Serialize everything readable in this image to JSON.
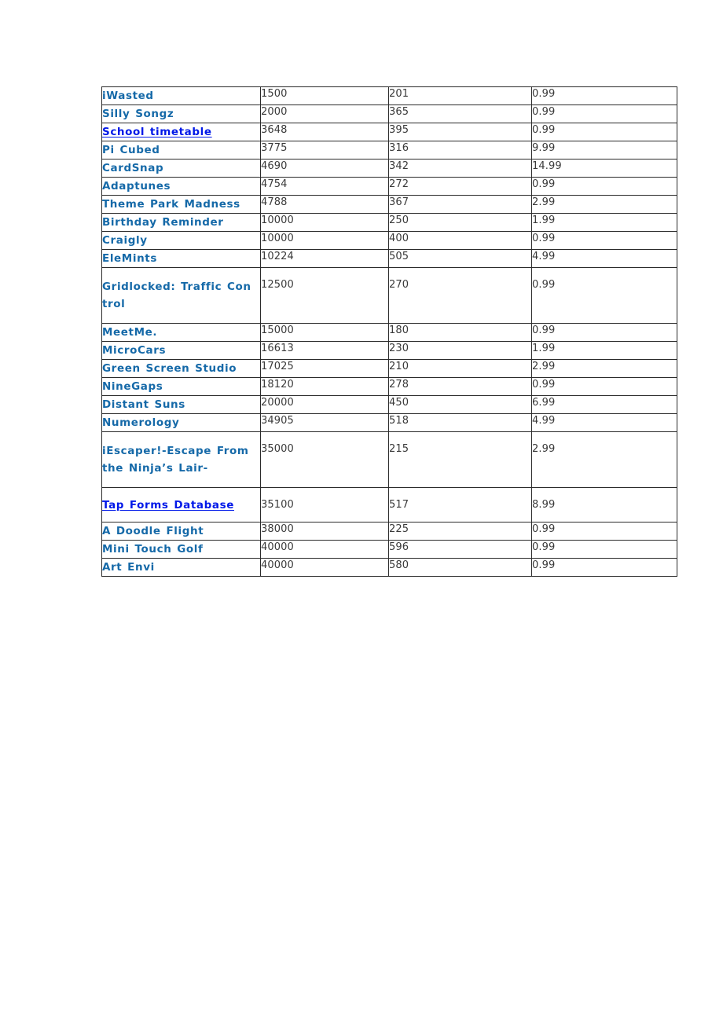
{
  "document": {
    "title": "App Listing Table",
    "background_color": "#ffffff",
    "table_border_color": "#2b2b2b",
    "link_color_plain": "#1569a8",
    "link_color_hyperlink": "#0018e8",
    "number_color": "#3a3a3a"
  },
  "table": {
    "columns": [
      "app_name",
      "downloads",
      "size",
      "price"
    ],
    "rows": [
      {
        "name": "iWasted",
        "downloads": "1500",
        "size": "201",
        "price": "0.99",
        "style": "plain",
        "layout": "single"
      },
      {
        "name": "Silly Songz",
        "downloads": "2000",
        "size": "365",
        "price": "0.99",
        "style": "plain",
        "layout": "single"
      },
      {
        "name": "School timetable",
        "downloads": "3648",
        "size": "395",
        "price": "0.99",
        "style": "hyper",
        "layout": "single"
      },
      {
        "name": "Pi Cubed",
        "downloads": "3775",
        "size": "316",
        "price": "9.99",
        "style": "plain",
        "layout": "single"
      },
      {
        "name": "CardSnap",
        "downloads": "4690",
        "size": "342",
        "price": "14.99",
        "style": "plain",
        "layout": "single"
      },
      {
        "name": "Adaptunes",
        "downloads": "4754",
        "size": "272",
        "price": "0.99",
        "style": "plain",
        "layout": "single"
      },
      {
        "name": "Theme Park Madness",
        "downloads": "4788",
        "size": "367",
        "price": "2.99",
        "style": "plain",
        "layout": "single"
      },
      {
        "name": "Birthday Reminder",
        "downloads": "10000",
        "size": "250",
        "price": "1.99",
        "style": "plain",
        "layout": "single"
      },
      {
        "name": "Craigly",
        "downloads": "10000",
        "size": "400",
        "price": "0.99",
        "style": "plain",
        "layout": "single"
      },
      {
        "name": "EleMints",
        "downloads": "10224",
        "size": "505",
        "price": "4.99",
        "style": "plain",
        "layout": "single"
      },
      {
        "name": "Gridlocked: Traffic Con trol",
        "downloads": "12500",
        "size": "270",
        "price": "0.99",
        "style": "plain",
        "layout": "wrap"
      },
      {
        "name": "MeetMe.",
        "downloads": "15000",
        "size": "180",
        "price": "0.99",
        "style": "plain",
        "layout": "single"
      },
      {
        "name": "MicroCars",
        "downloads": "16613",
        "size": "230",
        "price": "1.99",
        "style": "plain",
        "layout": "single"
      },
      {
        "name": "Green Screen Studio",
        "downloads": "17025",
        "size": "210",
        "price": "2.99",
        "style": "plain",
        "layout": "single"
      },
      {
        "name": "NineGaps",
        "downloads": "18120",
        "size": "278",
        "price": "0.99",
        "style": "plain",
        "layout": "single"
      },
      {
        "name": "Distant Suns",
        "downloads": "20000",
        "size": "450",
        "price": "6.99",
        "style": "plain",
        "layout": "single"
      },
      {
        "name": "Numerology",
        "downloads": "34905",
        "size": "518",
        "price": "4.99",
        "style": "plain",
        "layout": "single"
      },
      {
        "name": "iEscaper!-Escape From the Ninja’s Lair-",
        "downloads": "35000",
        "size": "215",
        "price": "2.99",
        "style": "plain",
        "layout": "wrap"
      },
      {
        "name": "Tap Forms Database",
        "downloads": "35100",
        "size": "517",
        "price": "8.99",
        "style": "hyper",
        "layout": "center"
      },
      {
        "name": "A Doodle Flight",
        "downloads": "38000",
        "size": "225",
        "price": "0.99",
        "style": "plain",
        "layout": "single"
      },
      {
        "name": "Mini Touch Golf",
        "downloads": "40000",
        "size": "596",
        "price": "0.99",
        "style": "plain",
        "layout": "single"
      },
      {
        "name": "Art Envi",
        "downloads": "40000",
        "size": "580",
        "price": "0.99",
        "style": "plain",
        "layout": "single"
      }
    ]
  }
}
